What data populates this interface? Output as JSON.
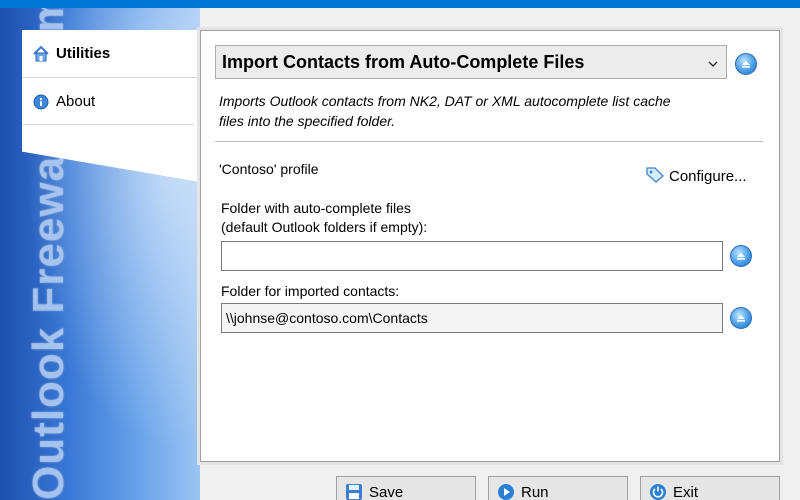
{
  "brand": {
    "text": "Outlook Freeware .com"
  },
  "sidebar": {
    "items": [
      {
        "label": "Utilities",
        "icon": "home-icon",
        "active": true
      },
      {
        "label": "About",
        "icon": "info-icon",
        "active": false
      }
    ]
  },
  "action": {
    "selected": "Import Contacts from Auto-Complete Files",
    "description_line1": "Imports Outlook contacts from NK2, DAT or XML autocomplete list cache",
    "description_line2": "files into the specified folder."
  },
  "profile": {
    "label": "'Contoso' profile",
    "configure_label": "Configure..."
  },
  "fields": {
    "autocomplete_folder": {
      "label_line1": "Folder with auto-complete files",
      "label_line2": "(default Outlook folders if empty):",
      "value": ""
    },
    "contacts_folder": {
      "label": "Folder for imported contacts:",
      "value": "\\\\johnse@contoso.com\\Contacts"
    }
  },
  "buttons": {
    "save": "Save",
    "run": "Run",
    "exit": "Exit"
  },
  "colors": {
    "accent": "#0078d7",
    "sidebar_dark": "#1d4fae",
    "sidebar_light": "#9cc4f2"
  }
}
